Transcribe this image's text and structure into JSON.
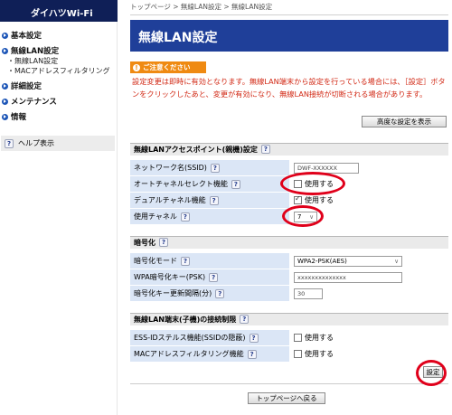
{
  "brand": "ダイハツWi-Fi",
  "nav": {
    "basic": "基本設定",
    "wlan": "無線LAN設定",
    "wlan_sub": "無線LAN設定",
    "mac_sub": "MACアドレスフィルタリング",
    "detail": "詳細設定",
    "maintenance": "メンテナンス",
    "info": "情報",
    "help": "ヘルプ表示"
  },
  "breadcrumb": "トップページ > 無線LAN設定 > 無線LAN設定",
  "page_title": "無線LAN設定",
  "notice": {
    "badge": "ご注意ください",
    "text": "設定変更は即時に有効となります。無線LAN端末から設定を行っている場合には、［設定］ボタンをクリックしたあと、変更が有効になり、無線LAN接続が切断される場合があります。"
  },
  "advanced_button": "高度な設定を表示",
  "sections": {
    "ap": {
      "title": "無線LANアクセスポイント(親機)設定",
      "ssid_label": "ネットワーク名(SSID)",
      "ssid_value": "DWF-XXXXXX",
      "auto_channel_label": "オートチャネルセレクト機能",
      "auto_channel_text": "使用する",
      "dual_channel_label": "デュアルチャネル機能",
      "dual_channel_text": "使用する",
      "channel_label": "使用チャネル",
      "channel_value": "7"
    },
    "enc": {
      "title": "暗号化",
      "mode_label": "暗号化モード",
      "mode_value": "WPA2-PSK(AES)",
      "psk_label": "WPA暗号化キー(PSK)",
      "psk_value": "xxxxxxxxxxxxxx",
      "interval_label": "暗号化キー更新間隔(分)",
      "interval_value": "30"
    },
    "limit": {
      "title": "無線LAN端末(子機)の接続制限",
      "stealth_label": "ESS-IDステルス機能(SSIDの隠蔽)",
      "stealth_text": "使用する",
      "mac_label": "MACアドレスフィルタリング機能",
      "mac_text": "使用する"
    }
  },
  "set_button": "設定",
  "back_button": "トップページへ戻る",
  "help_icon_glyph": "?",
  "colors": {
    "brand_bg": "#0f1f57",
    "title_bg": "#1f3f99",
    "notice_text": "#d22a16",
    "badge": "#ef8a12",
    "label_bg": "#dbe6f6",
    "highlight": "#e0001a"
  }
}
